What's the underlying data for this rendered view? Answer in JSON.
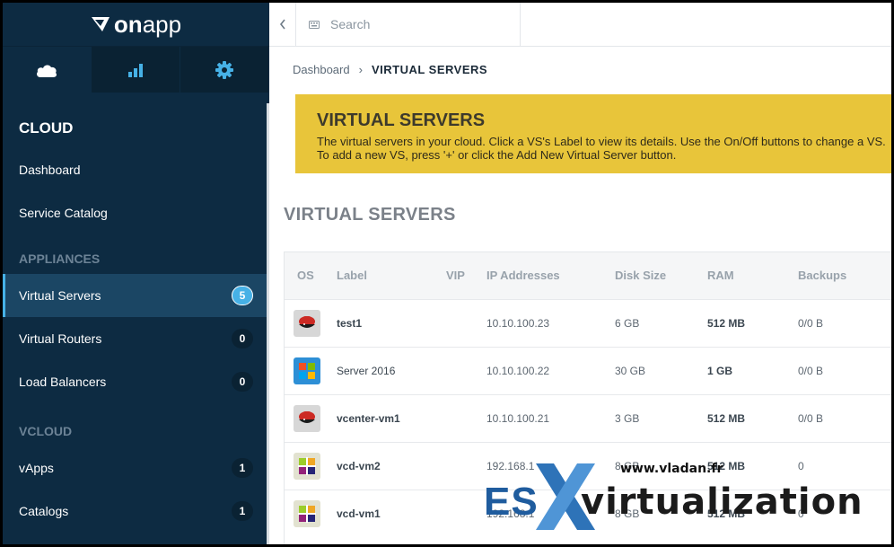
{
  "brand": {
    "logo_text_bold": "on",
    "logo_text": "app"
  },
  "sidebar": {
    "icon_tabs": [
      {
        "icon": "cloud-icon",
        "active": true
      },
      {
        "icon": "bar-chart-icon",
        "active": false
      },
      {
        "icon": "gear-icon",
        "active": false
      }
    ],
    "section_title": "CLOUD",
    "top_items": [
      {
        "label": "Dashboard"
      },
      {
        "label": "Service Catalog"
      }
    ],
    "appliances_label": "APPLIANCES",
    "appliances": [
      {
        "label": "Virtual Servers",
        "count": "5",
        "active": true
      },
      {
        "label": "Virtual Routers",
        "count": "0",
        "active": false
      },
      {
        "label": "Load Balancers",
        "count": "0",
        "active": false
      }
    ],
    "vcloud_label": "VCLOUD",
    "vcloud": [
      {
        "label": "vApps",
        "count": "1"
      },
      {
        "label": "Catalogs",
        "count": "1"
      }
    ]
  },
  "topbar": {
    "collapse_icon": "chevron-left-icon",
    "search_placeholder": "Search"
  },
  "breadcrumb": {
    "home": "Dashboard",
    "separator": "›",
    "current": "VIRTUAL SERVERS"
  },
  "banner": {
    "title": "VIRTUAL SERVERS",
    "text": "The virtual servers in your cloud. Click a VS's Label to view its details. Use the On/Off buttons to change a VS. To add a new VS, press '+' or click the Add New Virtual Server button."
  },
  "page_title": "VIRTUAL SERVERS",
  "table": {
    "columns": [
      "OS",
      "Label",
      "VIP",
      "IP Addresses",
      "Disk Size",
      "RAM",
      "Backups"
    ],
    "rows": [
      {
        "os": "redhat",
        "label": "test1",
        "vip": "",
        "ip": "10.10.100.23",
        "disk": "6 GB",
        "ram": "512 MB",
        "backups": "0/0 B"
      },
      {
        "os": "windows",
        "label": "Server 2016",
        "vip": "",
        "ip": "10.10.100.22",
        "disk": "30 GB",
        "ram": "1 GB",
        "backups": "0/0 B"
      },
      {
        "os": "redhat",
        "label": "vcenter-vm1",
        "vip": "",
        "ip": "10.10.100.21",
        "disk": "3 GB",
        "ram": "512 MB",
        "backups": "0/0 B"
      },
      {
        "os": "centos",
        "label": "vcd-vm2",
        "vip": "",
        "ip": "192.168.1",
        "disk": "8 GB",
        "ram": "512 MB",
        "backups": "0"
      },
      {
        "os": "centos",
        "label": "vcd-vm1",
        "vip": "",
        "ip": "192.168.1",
        "disk": "8 GB",
        "ram": "512 MB",
        "backups": "0"
      }
    ]
  },
  "watermark": {
    "url": "www.vladan.fr",
    "es": "ES",
    "virt": "virtualization"
  },
  "colors": {
    "sidebar_bg": "#0d2b42",
    "accent": "#46b1e6",
    "banner": "#e8c53a"
  }
}
